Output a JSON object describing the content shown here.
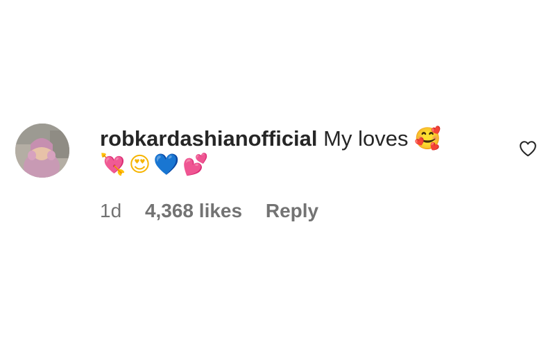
{
  "comment": {
    "username": "robkardashianofficial",
    "text": "My loves",
    "emoji_inline": "🥰",
    "emoji_line": [
      "💘",
      "😍",
      "💙",
      "💕"
    ],
    "time": "1d",
    "likes": "4,368 likes",
    "reply_label": "Reply"
  },
  "icons": {
    "avatar": "avatar-photo",
    "like": "heart-outline-icon"
  },
  "colors": {
    "text_primary": "#262626",
    "text_secondary": "#737373",
    "background": "#ffffff"
  }
}
